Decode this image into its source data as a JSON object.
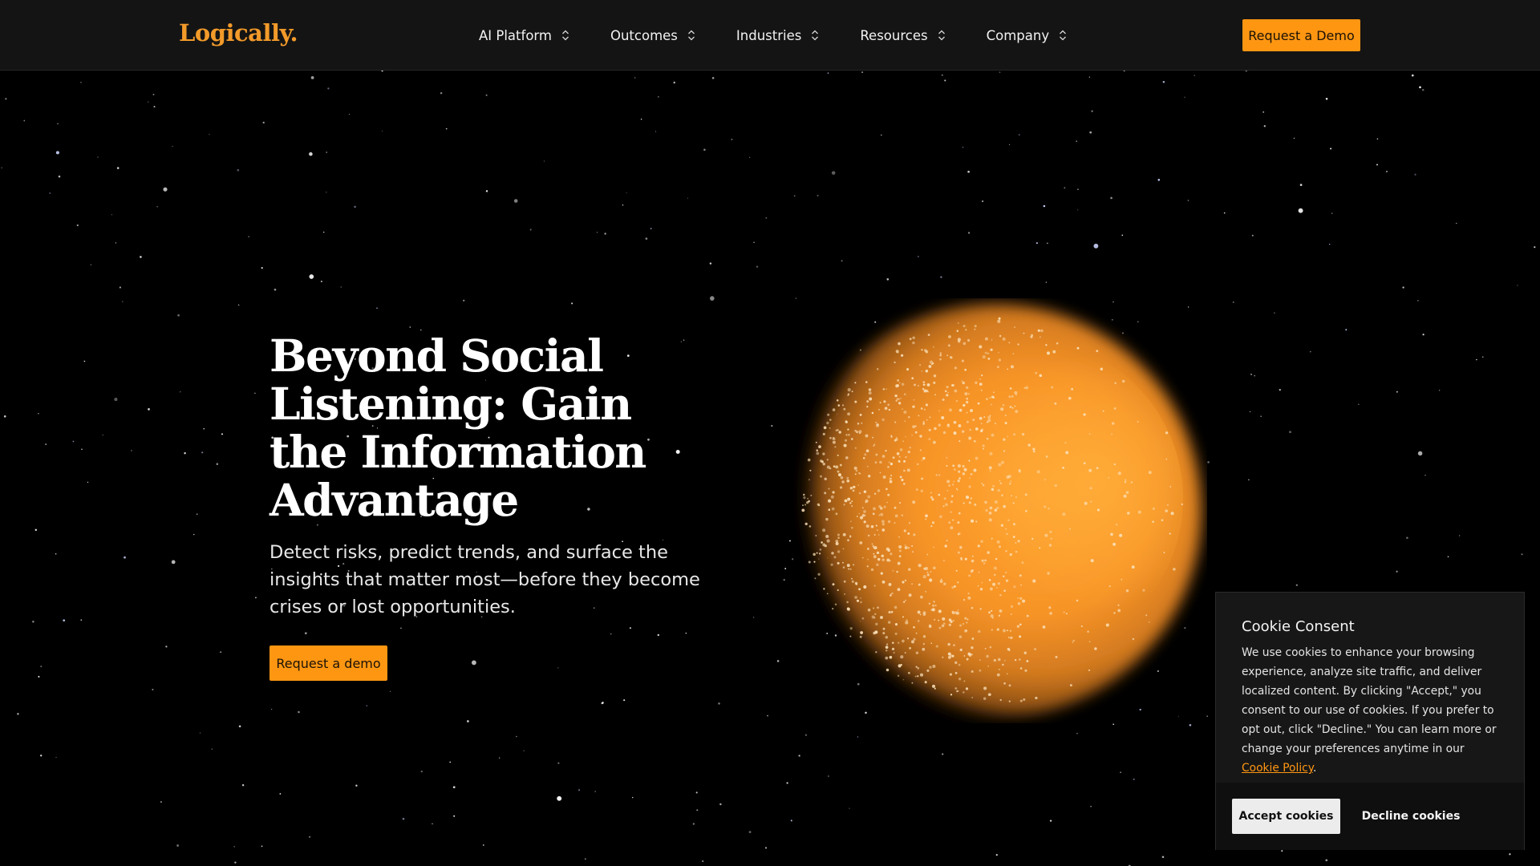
{
  "nav": {
    "logo": "Logically.",
    "items": [
      {
        "label": "AI Platform"
      },
      {
        "label": "Outcomes"
      },
      {
        "label": "Industries"
      },
      {
        "label": "Resources"
      },
      {
        "label": "Company"
      }
    ],
    "cta_label": "Request a Demo"
  },
  "hero": {
    "title": "Beyond Social Listening: Gain the Information Advantage",
    "subtitle": "Detect risks, predict trends, and surface the insights that matter most—before they become crises or lost opportunities.",
    "cta_label": "Request a demo"
  },
  "cookie": {
    "title": "Cookie Consent",
    "text": "We use cookies to enhance your browsing experience, analyze site traffic, and deliver localized content. By clicking \"Accept,\" you consent to our use of cookies. If you prefer to opt out, click \"Decline.\" You can learn more or change your preferences anytime in our ",
    "link_label": "Cookie Policy",
    "text_end": ".",
    "accept_label": "Accept cookies",
    "decline_label": "Decline cookies"
  },
  "colors": {
    "accent": "#ff9612",
    "nav_bg": "#141414",
    "page_bg": "#000000",
    "orb": "#ffa030"
  },
  "icons": {
    "nav_chevron": "chevron-up-down-icon"
  }
}
